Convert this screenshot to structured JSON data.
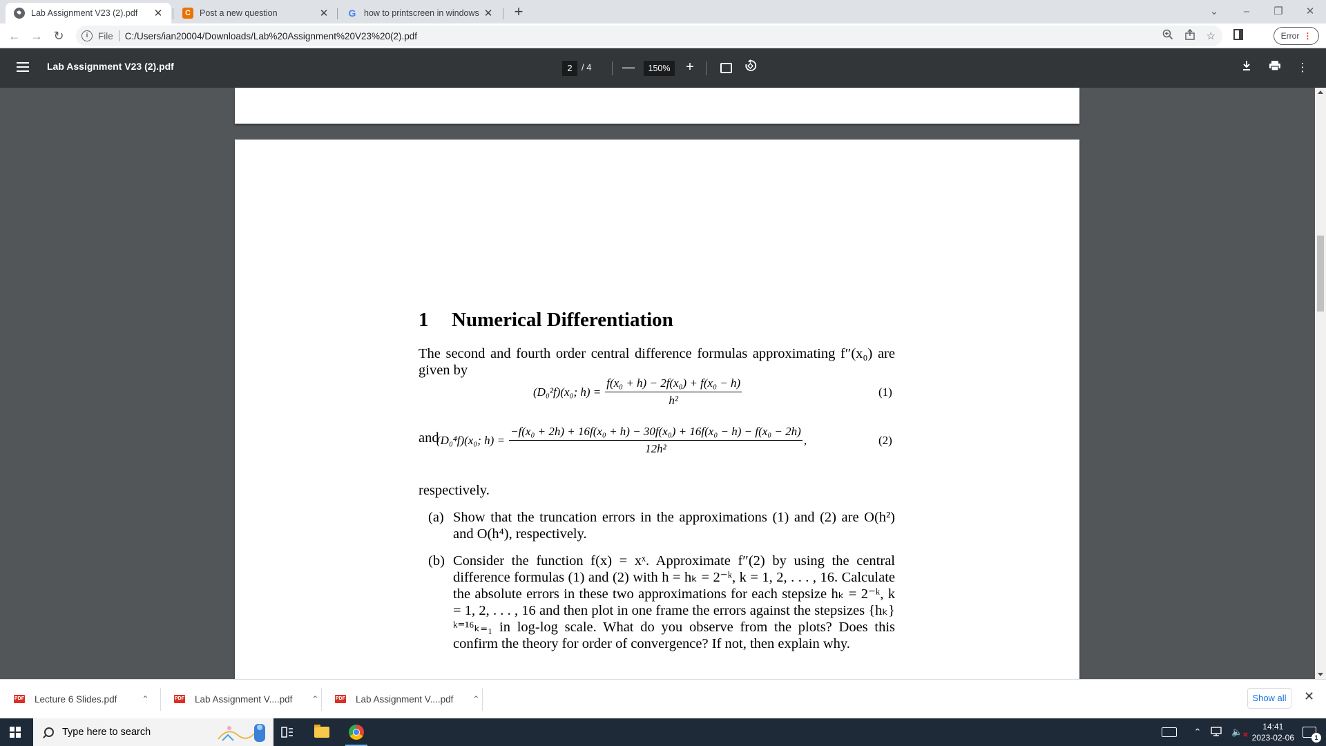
{
  "tabs": [
    {
      "title": "Lab Assignment V23 (2).pdf",
      "icon": "globe-icon",
      "active": true
    },
    {
      "title": "Post a new question",
      "icon": "chegg-icon",
      "icon_letter": "C",
      "active": false
    },
    {
      "title": "how to printscreen in windows -",
      "icon": "google-icon",
      "icon_letter": "G",
      "active": false
    }
  ],
  "address_bar": {
    "scheme_label": "File",
    "url": "C:/Users/ian20004/Downloads/Lab%20Assignment%20V23%20(2).pdf"
  },
  "profile": {
    "label": "Error"
  },
  "pdf_viewer": {
    "title": "Lab Assignment V23 (2).pdf",
    "current_page": "2",
    "page_total": "/  4",
    "zoom": "150%"
  },
  "document": {
    "section_number": "1",
    "section_title": "Numerical Differentiation",
    "intro": "The second and fourth order central difference formulas approximating f″(x₀) are given by",
    "eq1_lhs": "(D₀²f)(x₀; h) =",
    "eq1_num": "f(x₀ + h) − 2f(x₀) + f(x₀ − h)",
    "eq1_den": "h²",
    "eq1_no": "(1)",
    "and_text": "and",
    "eq2_lhs": "(D₀⁴f)(x₀; h) =",
    "eq2_num": "−f(x₀ + 2h) + 16f(x₀ + h) − 30f(x₀) + 16f(x₀ − h) − f(x₀ − 2h)",
    "eq2_den": "12h²",
    "eq2_tail": ",",
    "eq2_no": "(2)",
    "respectively": "respectively.",
    "items": [
      {
        "label": "(a)",
        "text": "Show that the truncation errors in the approximations (1) and (2) are O(h²) and O(h⁴), respectively."
      },
      {
        "label": "(b)",
        "text": "Consider the function f(x) = xˣ. Approximate f″(2) by using the central difference formulas (1) and (2) with h = hₖ = 2⁻ᵏ, k = 1, 2, . . . , 16. Calculate the absolute errors in these two approximations for each stepsize hₖ = 2⁻ᵏ, k = 1, 2, . . . , 16 and then plot in one frame the errors against the stepsizes {hₖ}ᵏ⁼¹⁶ₖ₌₁ in log-log scale. What do you observe from the plots? Does this confirm the theory for order of convergence? If not, then explain why."
      }
    ]
  },
  "downloads": [
    {
      "name": "Lecture 6 Slides.pdf",
      "icon": "pdf-icon",
      "badge": "PDF"
    },
    {
      "name": "Lab Assignment V....pdf",
      "icon": "pdf-icon",
      "badge": "PDF"
    },
    {
      "name": "Lab Assignment V....pdf",
      "icon": "pdf-icon",
      "badge": "PDF"
    }
  ],
  "downloads_show_all": "Show all",
  "taskbar": {
    "search_placeholder": "Type here to search",
    "time": "14:41",
    "date": "2023-02-06",
    "notification_count": "1"
  },
  "colors": {
    "pdf_toolbar": "#323639",
    "viewer_background": "#525659",
    "taskbar": "#1e2a38",
    "accent_link": "#1a73e8",
    "pdf_badge": "#d93025"
  }
}
